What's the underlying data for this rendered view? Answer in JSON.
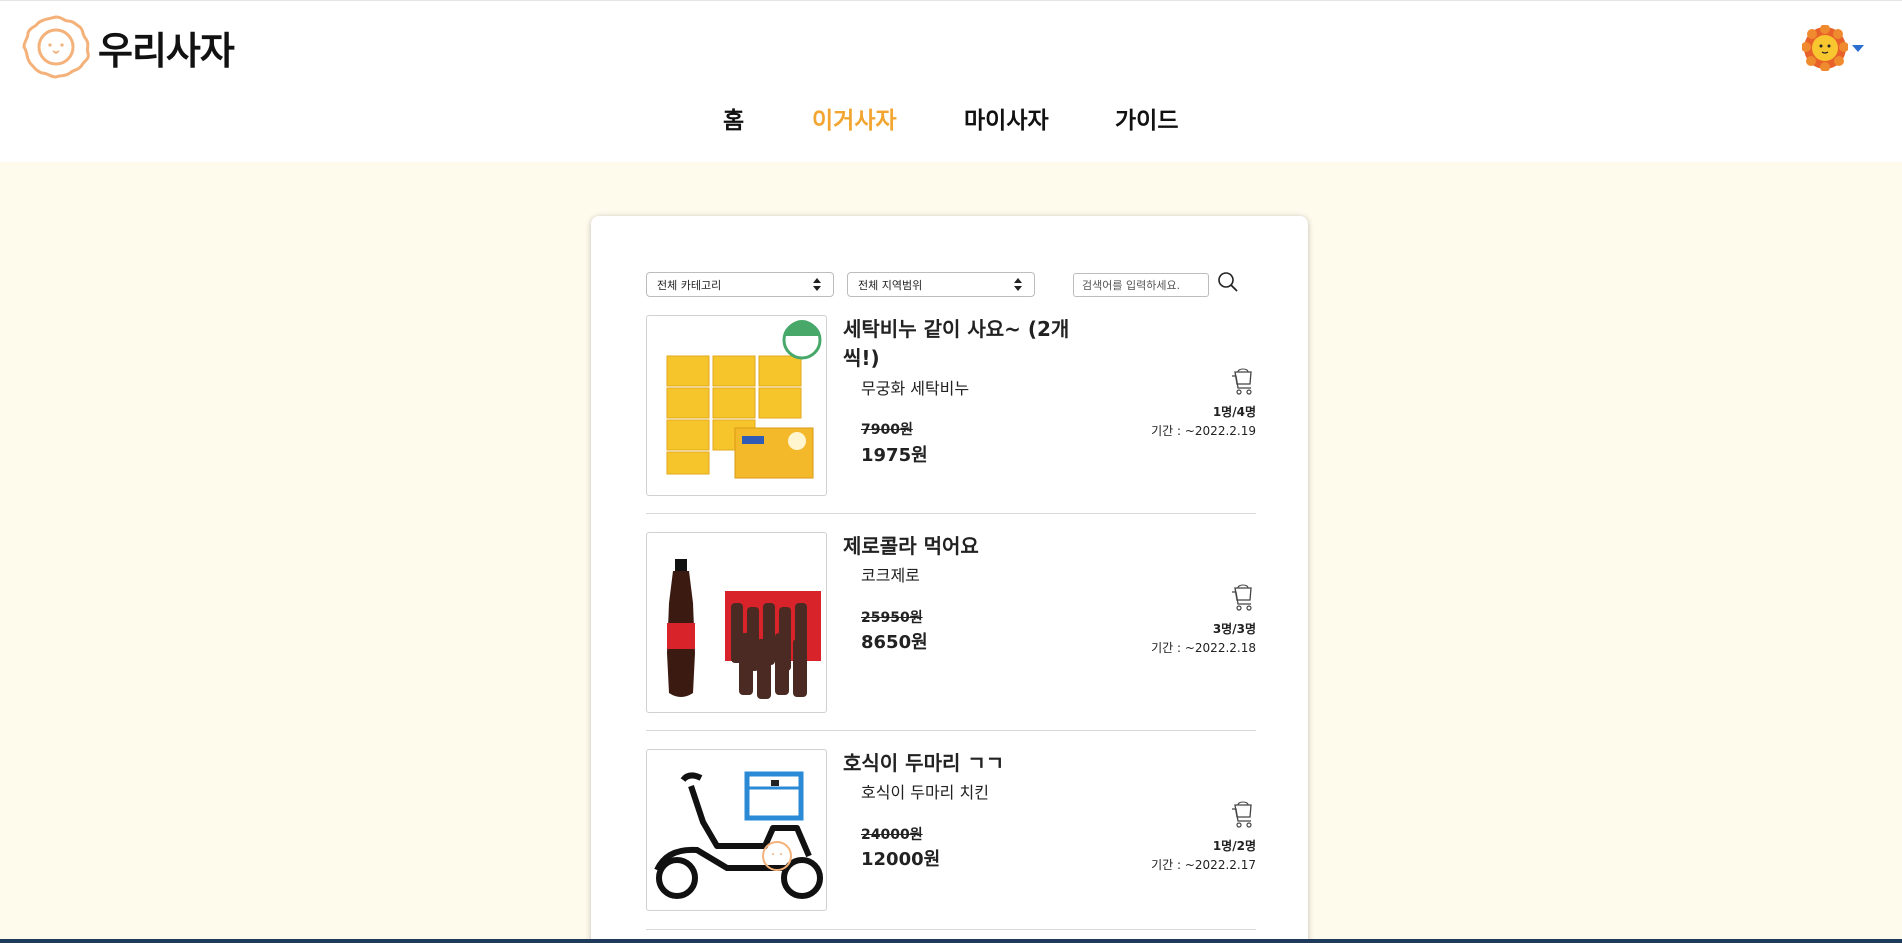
{
  "brand": {
    "name": "우리사자"
  },
  "nav": [
    {
      "label": "홈"
    },
    {
      "label": "이거사자"
    },
    {
      "label": "마이사자"
    },
    {
      "label": "가이드"
    }
  ],
  "colors": {
    "active_nav": "#f2a530",
    "background": "#fefaec",
    "panel": "#ffffff"
  },
  "filters": {
    "category": "전체 카테고리",
    "region": "전체 지역범위",
    "search_placeholder": "검색어를 입력하세요."
  },
  "items": [
    {
      "title": "세탁비누 같이 사요~ (2개씩!)",
      "product": "무궁화 세탁비누",
      "original_price": "7900원",
      "price": "1975원",
      "participants": "1명/4명",
      "period": "기간 : ~2022.2.19",
      "image_icon": "laundry-soap-image"
    },
    {
      "title": "제로콜라 먹어요",
      "product": "코크제로",
      "original_price": "25950원",
      "price": "8650원",
      "participants": "3명/3명",
      "period": "기간 : ~2022.2.18",
      "image_icon": "cola-bottles-image"
    },
    {
      "title": "호식이 두마리 ㄱㄱ",
      "product": "호식이 두마리 치킨",
      "original_price": "24000원",
      "price": "12000원",
      "participants": "1명/2명",
      "period": "기간 : ~2022.2.17",
      "image_icon": "delivery-scooter-image"
    }
  ]
}
